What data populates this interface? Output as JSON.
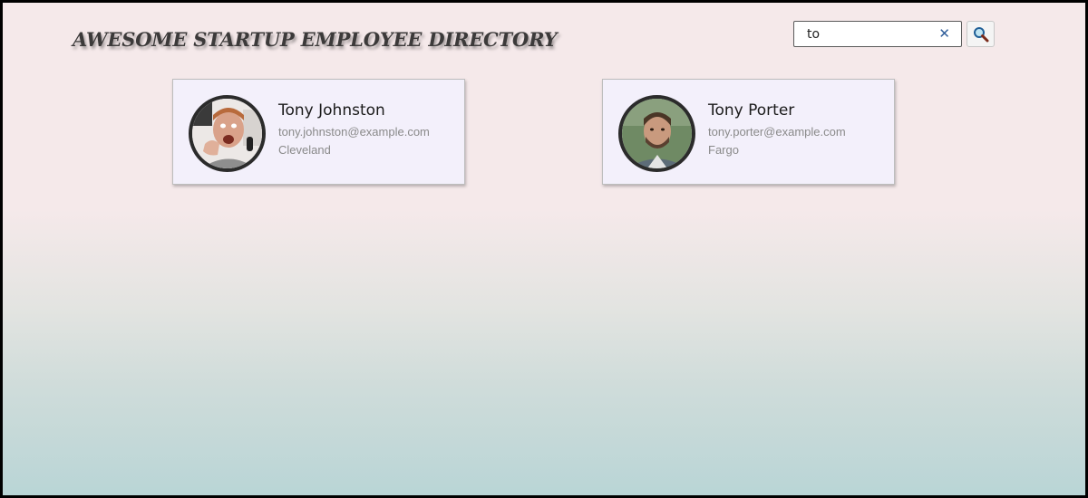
{
  "header": {
    "title": "AWESOME STARTUP EMPLOYEE DIRECTORY"
  },
  "search": {
    "value": "to",
    "clear_label": "✕",
    "icon": "magnifier-icon"
  },
  "employees": [
    {
      "name": "Tony Johnston",
      "email": "tony.johnston@example.com",
      "city": "Cleveland",
      "avatar": "avatar-photo"
    },
    {
      "name": "Tony Porter",
      "email": "tony.porter@example.com",
      "city": "Fargo",
      "avatar": "avatar-photo"
    }
  ],
  "colors": {
    "title": "#3c3a3a",
    "card_bg": "#f3f0fb",
    "avatar_border": "#2b2b2b",
    "clear_icon": "#2f5d9a"
  }
}
